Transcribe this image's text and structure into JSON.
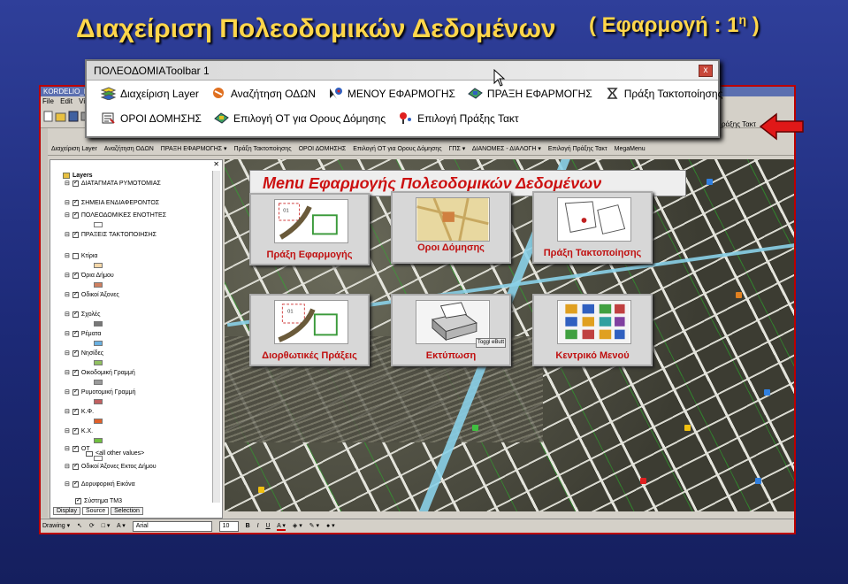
{
  "slide": {
    "title": "Διαχείριση Πολεοδομικών Δεδομένων",
    "subtitle_main": "( Εφαρμογή : 1",
    "subtitle_sup": "η",
    "subtitle_end": " )"
  },
  "window": {
    "title": "KORDELIO_POL",
    "menubar": [
      "File",
      "Edit",
      "View"
    ]
  },
  "floating_toolbar": {
    "title": "ΠΟΛΕΟΔΟΜΙΑToolbar 1",
    "close": "x",
    "row1": [
      "Διαχείριση Layer",
      "Αναζήτηση ΟΔΩΝ",
      "ΜΕΝΟΥ ΕΦΑΡΜΟΓΗΣ",
      "ΠΡΑΞΗ ΕΦΑΡΜΟΓΗΣ",
      "Πράξη Τακτοποίησης"
    ],
    "row2": [
      "ΟΡΟΙ ΔΟΜΗΣΗΣ",
      "Επιλογή ΟΤ για Ορους Δόμησης",
      "Επιλογή Πράξης Τακτ"
    ]
  },
  "docked_toolbar": {
    "items": [
      "Διαχείριση Layer",
      "Αναζήτηση ΟΔΩΝ",
      "ΠΡΑΞΗ ΕΦΑΡΜΟΓΗΣ ▾",
      "Πράξη Τακτοποίησης",
      "ΟΡΟΙ ΔΟΜΗΣΗΣ",
      "Επιλογή ΟΤ για Ορους Δόμησης",
      "ΓΠΣ ▾",
      "ΔΙΑΝΟΜΕΣ - ΔΙΑΛΟΓΗ ▾",
      "Επιλογή Πράξης Τακτ",
      "MegaMenu"
    ],
    "right_label": "ράξης Τακτ"
  },
  "toc": {
    "root": "Layers",
    "layers": [
      {
        "name": "ΔΙΑΤΑΓΜΑΤΑ ΡΥΜΟΤΟΜΙΑΣ",
        "checked": true,
        "swatch": ""
      },
      {
        "name": "ΣΗΜΕΙΑ ΕΝΔΙΑΦΕΡΟΝΤΟΣ",
        "checked": true,
        "swatch": ""
      },
      {
        "name": "ΠΟΛΕΟΔΟΜΙΚΕΣ ΕΝΟΤΗΤΕΣ",
        "checked": true,
        "swatch": "#ffffff"
      },
      {
        "name": "ΠΡΑΞΕΙΣ ΤΑΚΤΟΠΟΙΗΣΗΣ",
        "checked": true,
        "swatch": ""
      },
      {
        "name": "Κτίρια",
        "checked": false,
        "swatch": "#f4d7a8"
      },
      {
        "name": "Όρια Δήμου",
        "checked": true,
        "swatch": "#d08060"
      },
      {
        "name": "Οδικοί Άξονες",
        "checked": true,
        "swatch": ""
      },
      {
        "name": "Σχολές",
        "checked": true,
        "swatch": "#777777"
      },
      {
        "name": "Ρέματα",
        "checked": true,
        "swatch": "#6ab0e0"
      },
      {
        "name": "Νησίδες",
        "checked": true,
        "swatch": "#90c060"
      },
      {
        "name": "Οικοδομική Γραμμή",
        "checked": true,
        "swatch": "#9a9a9a"
      },
      {
        "name": "Ρυμοτομική Γραμμή",
        "checked": true,
        "swatch": "#c06060"
      },
      {
        "name": "Κ.Φ.",
        "checked": true,
        "swatch": "#e0602a"
      },
      {
        "name": "Κ.Χ.",
        "checked": true,
        "swatch": "#70c040"
      },
      {
        "name": "ΟΤ",
        "checked": true,
        "swatch": "#ffffff"
      },
      {
        "name": "Οδικοί Άξονες Εκτος Δήμου",
        "checked": true,
        "swatch": ""
      },
      {
        "name": "Δορυφορική Εικόνα",
        "checked": true,
        "swatch": ""
      }
    ],
    "other_values": "<all other values>",
    "footer_group": "Σύστημα ΤΜ3",
    "tabs": [
      "Display",
      "Source",
      "Selection"
    ]
  },
  "menu_panel": {
    "title": "Menu Εφαρμογής  Πολεοδομικών Δεδομένων",
    "tiles": [
      {
        "label": "Πράξη Εφαρμογής"
      },
      {
        "label": "Οροι Δόμησης"
      },
      {
        "label": "Πράξη Τακτοποίησης"
      },
      {
        "label": "Διορθωτικές Πράξεις"
      },
      {
        "label": "Εκτύπωση"
      },
      {
        "label": "Κεντρικό Μενού"
      }
    ],
    "toggle_button": "Toggl eButt",
    "tile1_code": "01",
    "tile4_code": "01"
  },
  "statusbar": {
    "drawing": "Drawing ▾",
    "font": "Arial",
    "size": "10",
    "bold": "B",
    "italic": "I",
    "underline": "U"
  },
  "colors": {
    "slide_title": "#ffd64a",
    "menu_label": "#c01010",
    "arrow": "#e01818"
  }
}
